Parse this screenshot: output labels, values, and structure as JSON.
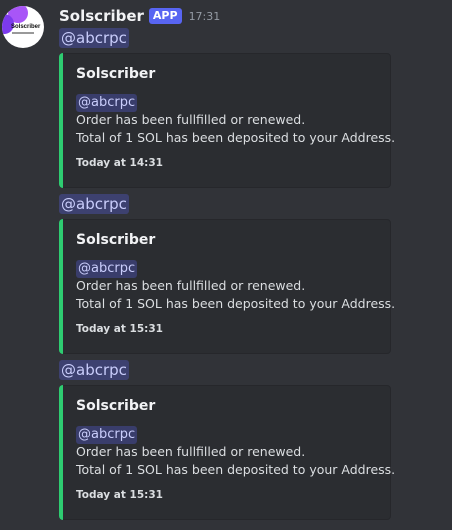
{
  "message": {
    "username": "Solscriber",
    "badge": "APP",
    "timestamp": "17:31",
    "avatar_text": "Solscriber"
  },
  "entries": [
    {
      "mention": "@abcrpc",
      "embed": {
        "title": "Solscriber",
        "mention": "@abcrpc",
        "line1": "Order has been fullfilled or renewed.",
        "line2": "Total of 1 SOL has been deposited to your Address.",
        "footer": "Today at 14:31"
      }
    },
    {
      "mention": "@abcrpc",
      "embed": {
        "title": "Solscriber",
        "mention": "@abcrpc",
        "line1": "Order has been fullfilled or renewed.",
        "line2": "Total of 1 SOL has been deposited to your Address.",
        "footer": "Today at 15:31"
      }
    },
    {
      "mention": "@abcrpc",
      "embed": {
        "title": "Solscriber",
        "mention": "@abcrpc",
        "line1": "Order has been fullfilled or renewed.",
        "line2": "Total of 1 SOL has been deposited to your Address.",
        "footer": "Today at 15:31"
      }
    }
  ],
  "colors": {
    "background": "#313338",
    "embed_bar": "#2ecc71",
    "app_badge": "#5865f2"
  }
}
